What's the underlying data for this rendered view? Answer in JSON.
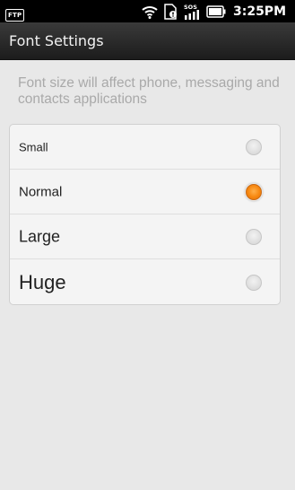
{
  "status_bar": {
    "ftp_label": "FTP",
    "time": "3:25PM",
    "icons": [
      "ftp-icon",
      "wifi-icon",
      "download-notification-icon",
      "signal-sos-icon",
      "battery-icon"
    ]
  },
  "title_bar": {
    "title": "Font Settings"
  },
  "description": "Font size will affect phone, messaging and contacts applications",
  "options": [
    {
      "label": "Small",
      "selected": false
    },
    {
      "label": "Normal",
      "selected": true
    },
    {
      "label": "Large",
      "selected": false
    },
    {
      "label": "Huge",
      "selected": false
    }
  ],
  "colors": {
    "accent": "#f7870f",
    "title_bar": "#2a2a2a",
    "background": "#e8e8e8"
  }
}
